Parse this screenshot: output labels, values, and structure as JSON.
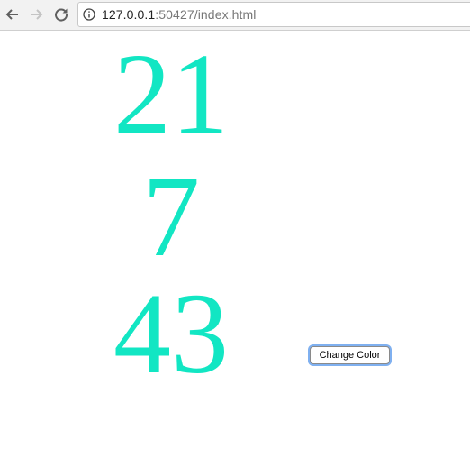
{
  "browser": {
    "url_host": "127.0.0.1",
    "url_rest": ":50427/index.html"
  },
  "numbers": [
    "21",
    "7",
    "43"
  ],
  "number_color": "#12e6c3",
  "button": {
    "label": "Change Color"
  },
  "icons": {
    "back": "back-arrow-icon",
    "forward": "forward-arrow-icon",
    "reload": "reload-icon",
    "info": "info-icon"
  }
}
